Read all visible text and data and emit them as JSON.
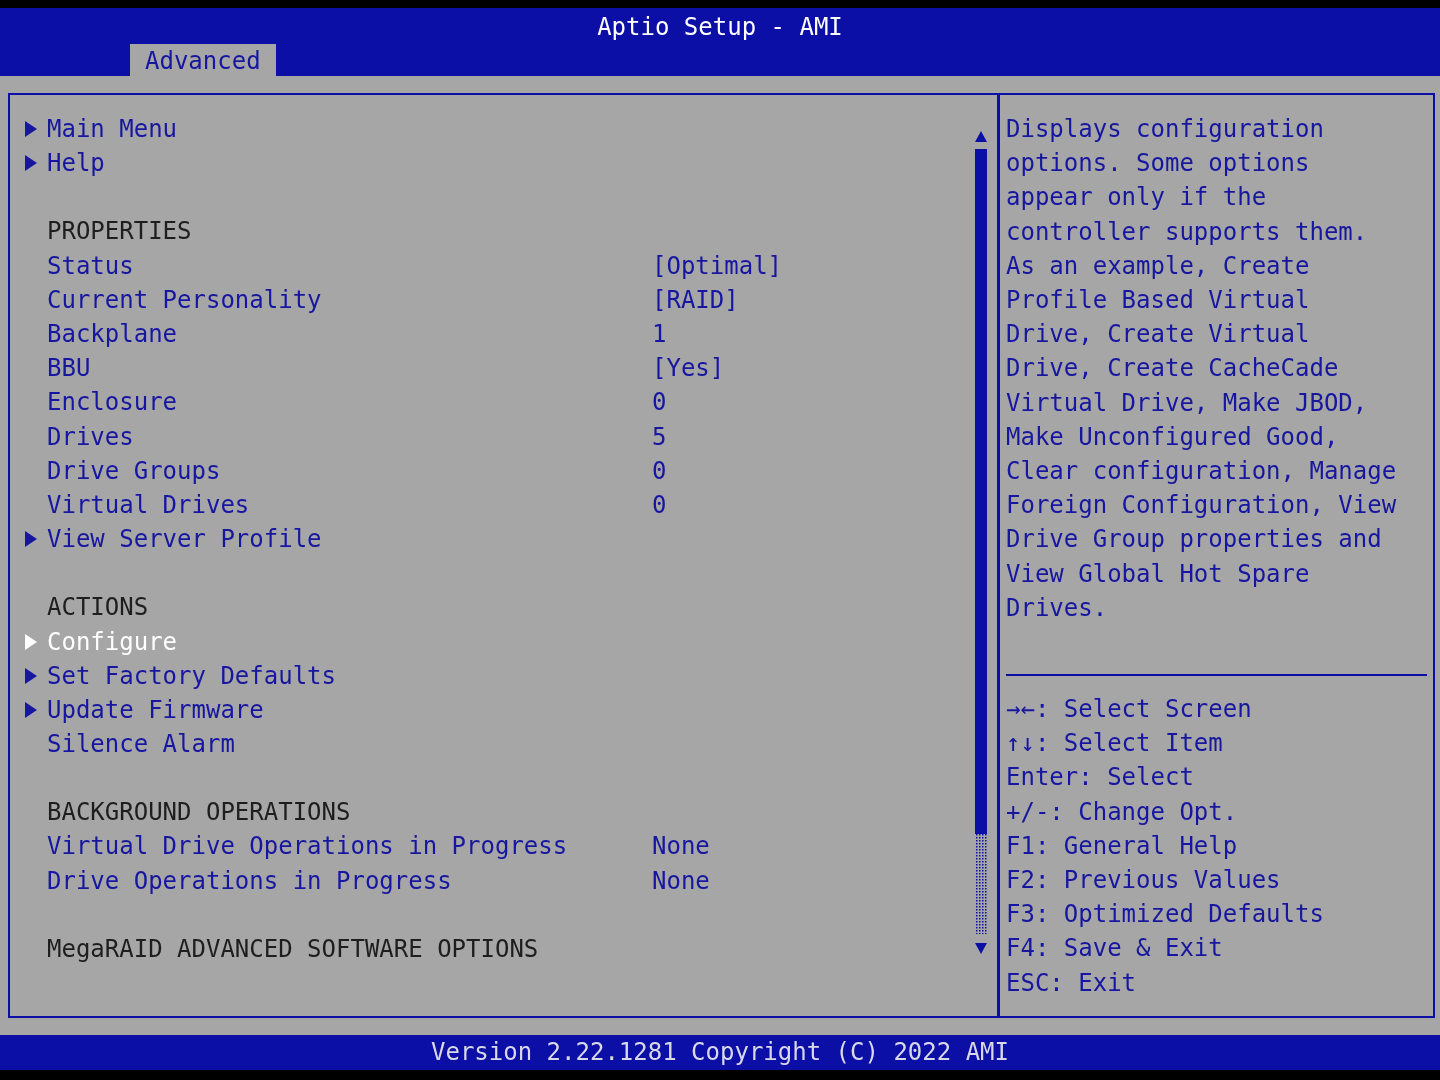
{
  "header": {
    "title": "Aptio Setup - AMI",
    "tabs": [
      {
        "label": "Advanced",
        "selected": true
      }
    ]
  },
  "sections": [
    {
      "items": [
        {
          "label": "Main Menu",
          "submenu": true,
          "selected": false
        },
        {
          "label": "Help",
          "submenu": true,
          "selected": false
        }
      ]
    },
    {
      "heading": "PROPERTIES",
      "items": [
        {
          "label": "Status",
          "value": "[Optimal]",
          "submenu": false,
          "selected": false
        },
        {
          "label": "Current Personality",
          "value": "[RAID]",
          "submenu": false,
          "selected": false
        },
        {
          "label": "Backplane",
          "value": "1",
          "submenu": false,
          "selected": false
        },
        {
          "label": "BBU",
          "value": "[Yes]",
          "submenu": false,
          "selected": false
        },
        {
          "label": "Enclosure",
          "value": "0",
          "submenu": false,
          "selected": false
        },
        {
          "label": "Drives",
          "value": "5",
          "submenu": false,
          "selected": false
        },
        {
          "label": "Drive Groups",
          "value": "0",
          "submenu": false,
          "selected": false
        },
        {
          "label": "Virtual Drives",
          "value": "0",
          "submenu": false,
          "selected": false
        },
        {
          "label": "View Server Profile",
          "submenu": true,
          "selected": false
        }
      ]
    },
    {
      "heading": "ACTIONS",
      "items": [
        {
          "label": "Configure",
          "submenu": true,
          "selected": true
        },
        {
          "label": "Set Factory Defaults",
          "submenu": true,
          "selected": false
        },
        {
          "label": "Update Firmware",
          "submenu": true,
          "selected": false
        },
        {
          "label": "Silence Alarm",
          "submenu": false,
          "selected": false
        }
      ]
    },
    {
      "heading": "BACKGROUND OPERATIONS",
      "items": [
        {
          "label": "Virtual Drive Operations in Progress",
          "value": "None",
          "submenu": false,
          "selected": false
        },
        {
          "label": "Drive Operations in Progress",
          "value": "None",
          "submenu": false,
          "selected": false
        }
      ]
    },
    {
      "heading": "MegaRAID ADVANCED SOFTWARE OPTIONS"
    }
  ],
  "help_text": "Displays configuration options. Some options appear only if the controller supports them. As an example, Create Profile Based Virtual Drive, Create Virtual Drive, Create CacheCade Virtual Drive, Make JBOD, Make Unconfigured Good, Clear configuration, Manage Foreign Configuration, View Drive Group properties and View Global Hot Spare Drives.",
  "key_help": [
    "→←: Select Screen",
    "↑↓: Select Item",
    "Enter: Select",
    "+/-: Change Opt.",
    "F1: General Help",
    "F2: Previous Values",
    "F3: Optimized Defaults",
    "F4: Save & Exit",
    "ESC: Exit"
  ],
  "footer": "Version 2.22.1281 Copyright (C) 2022 AMI"
}
